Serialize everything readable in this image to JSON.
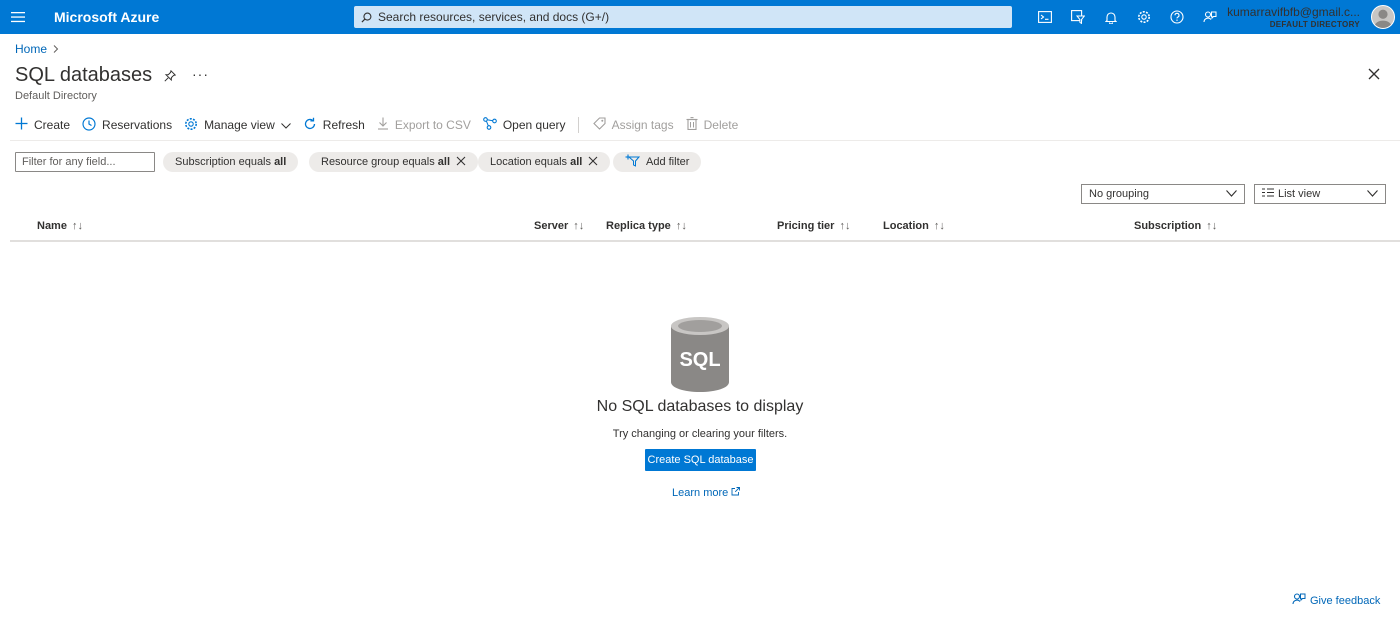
{
  "topbar": {
    "brand": "Microsoft Azure",
    "search_placeholder": "Search resources, services, and docs (G+/)",
    "account_email": "kumarravifbfb@gmail.c...",
    "account_directory": "DEFAULT DIRECTORY",
    "icons": [
      "cloud-shell-icon",
      "directory-filter-icon",
      "notifications-icon",
      "settings-icon",
      "help-icon",
      "feedback-icon"
    ],
    "accent": "#0078d4"
  },
  "breadcrumb": {
    "home": "Home"
  },
  "page": {
    "title": "SQL databases",
    "subtitle": "Default Directory"
  },
  "toolbar": {
    "create": "Create",
    "reservations": "Reservations",
    "manage_view": "Manage view",
    "refresh": "Refresh",
    "export_csv": "Export to CSV",
    "open_query": "Open query",
    "assign_tags": "Assign tags",
    "delete": "Delete"
  },
  "filters": {
    "placeholder": "Filter for any field...",
    "subscription_label": "Subscription equals ",
    "subscription_value": "all",
    "resource_group_label": "Resource group equals ",
    "resource_group_value": "all",
    "location_label": "Location equals ",
    "location_value": "all",
    "add_filter": "Add filter"
  },
  "view": {
    "grouping": "No grouping",
    "list_view": "List view"
  },
  "columns": {
    "name": "Name",
    "server": "Server",
    "replica_type": "Replica type",
    "pricing_tier": "Pricing tier",
    "location": "Location",
    "subscription": "Subscription"
  },
  "empty_state": {
    "icon_text": "SQL",
    "title": "No SQL databases to display",
    "subtitle": "Try changing or clearing your filters.",
    "button": "Create SQL database",
    "learn_more": "Learn more"
  },
  "feedback": "Give feedback"
}
